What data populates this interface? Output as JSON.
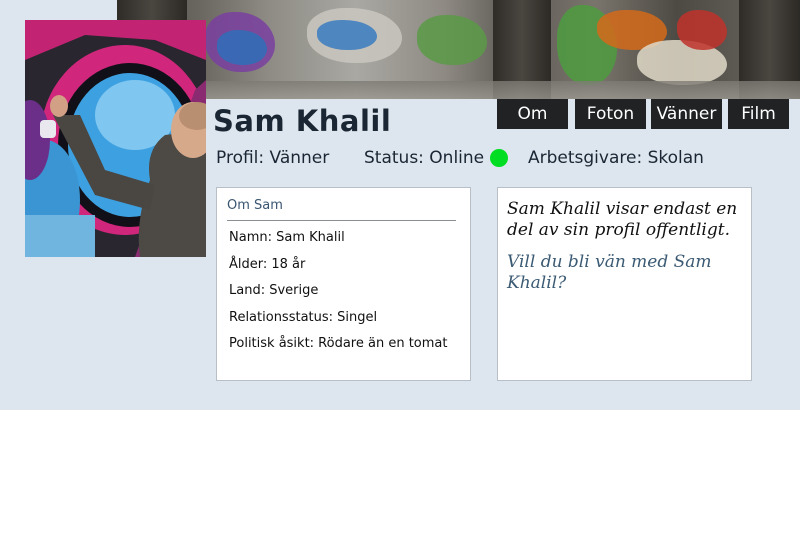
{
  "profile": {
    "name": "Sam Khalil",
    "visibility": "Profil: Vänner",
    "status": "Status: Online",
    "status_color": "#00dd22",
    "employer": "Arbetsgivare: Skolan"
  },
  "tabs": [
    "Om",
    "Foton",
    "Vänner",
    "Film"
  ],
  "about": {
    "heading": "Om Sam",
    "fields": [
      "Namn: Sam Khalil",
      "Ålder: 18 år",
      "Land: Sverige",
      "Relationsstatus: Singel",
      "Politisk åsikt: Rödare än en tomat"
    ]
  },
  "message": {
    "text": "Sam Khalil visar endast en del av sin profil offentligt.",
    "link": "Vill du bli vän med Sam Khalil?"
  },
  "colors": {
    "page_background": "#dde6ef",
    "tab_background": "#202224",
    "link_color": "#3b5a73"
  }
}
